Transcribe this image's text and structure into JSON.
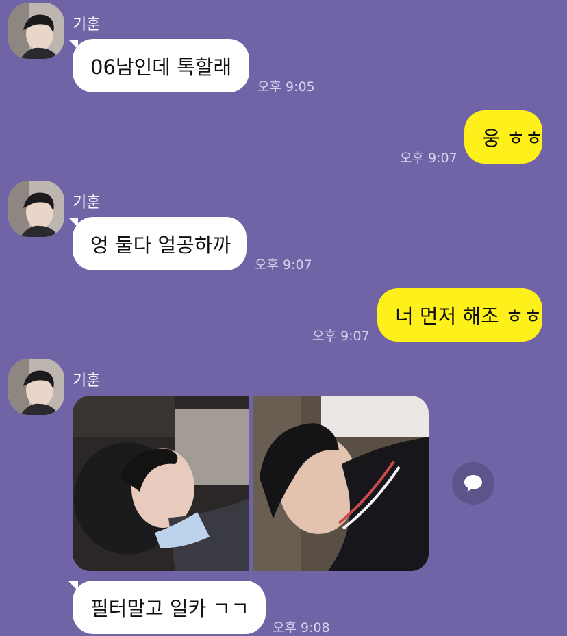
{
  "chat": {
    "sender_name": "기훈",
    "messages": [
      {
        "text": "06남인데 톡할래",
        "time": "오후 9:05"
      },
      {
        "text": "웅 ㅎㅎ",
        "time": "오후 9:07"
      },
      {
        "text": "엉 둘다 얼공하까",
        "time": "오후 9:07"
      },
      {
        "text": "너 먼저 해조 ㅎㅎ",
        "time": "오후 9:07"
      },
      {
        "text": "필터말고 일카 ㄱㄱ",
        "time": "오후 9:08"
      }
    ]
  },
  "colors": {
    "background": "#7164a6",
    "incoming_bubble": "#ffffff",
    "outgoing_bubble": "#fef01b"
  },
  "icons": {
    "comment_button": "speech-bubble-icon"
  }
}
